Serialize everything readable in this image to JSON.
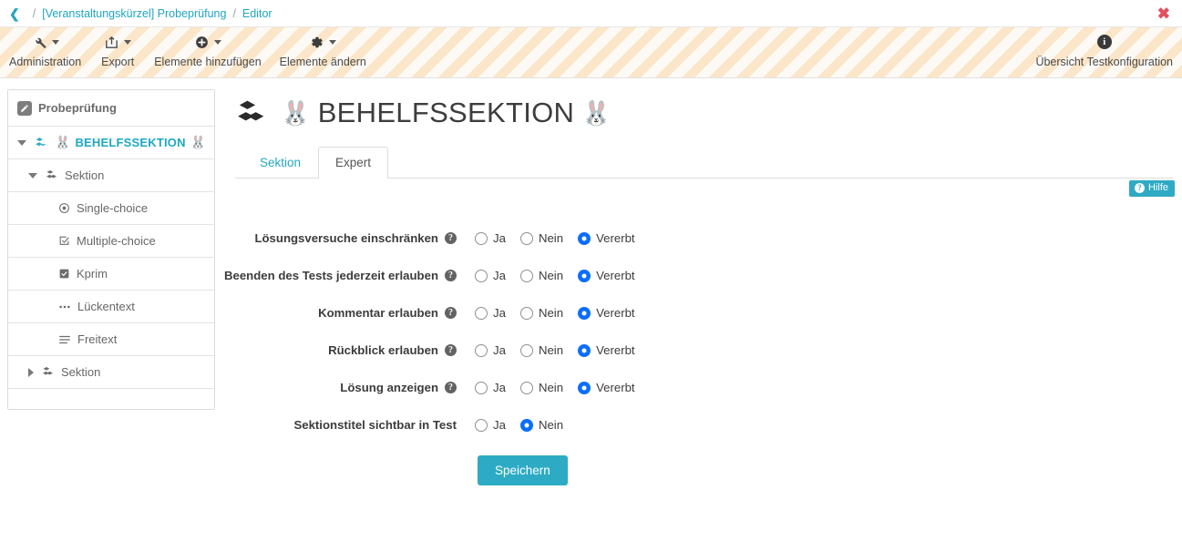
{
  "breadcrumb": {
    "back_icon": "chevron-left-icon",
    "items": [
      "[Veranstaltungskürzel] Probeprüfung",
      "Editor"
    ],
    "separator": "/",
    "close_label": "✖"
  },
  "toolbar": {
    "items": [
      {
        "label": "Administration",
        "icon": "wrench-icon",
        "has_caret": true
      },
      {
        "label": "Export",
        "icon": "share-box-icon",
        "has_caret": true
      },
      {
        "label": "Elemente hinzufügen",
        "icon": "plus-circle-icon",
        "has_caret": true
      },
      {
        "label": "Elemente ändern",
        "icon": "gear-icon",
        "has_caret": true
      }
    ],
    "right": {
      "label": "Übersicht Testkonfiguration",
      "icon": "info-circle-icon",
      "glyph": "i"
    }
  },
  "sidebar": {
    "header": {
      "label": "Probeprüfung",
      "icon": "pencil-icon"
    },
    "items": [
      {
        "label": "BEHELFSSEKTION",
        "icon": "blocks-icon",
        "emoji_before": "🐰",
        "emoji_after": "🐰",
        "state": "expanded",
        "level": 0,
        "active": true
      },
      {
        "label": "Sektion",
        "icon": "blocks-icon",
        "state": "expanded",
        "level": 1,
        "active": false
      },
      {
        "label": "Single-choice",
        "icon": "radio-icon",
        "state": "leaf",
        "level": 2,
        "active": false
      },
      {
        "label": "Multiple-choice",
        "icon": "checkbox-outline-icon",
        "state": "leaf",
        "level": 2,
        "active": false
      },
      {
        "label": "Kprim",
        "icon": "checkbox-filled-icon",
        "state": "leaf",
        "level": 2,
        "active": false
      },
      {
        "label": "Lückentext",
        "icon": "dots-icon",
        "state": "leaf",
        "level": 2,
        "active": false
      },
      {
        "label": "Freitext",
        "icon": "lines-icon",
        "state": "leaf",
        "level": 2,
        "active": false
      },
      {
        "label": "Sektion",
        "icon": "blocks-icon",
        "state": "collapsed",
        "level": 1,
        "active": false
      }
    ]
  },
  "page": {
    "title": "BEHELFSSEKTION",
    "title_icon": "blocks-icon",
    "emoji_before": "🐰",
    "emoji_after": "🐰"
  },
  "tabs": [
    {
      "label": "Sektion",
      "active": false
    },
    {
      "label": "Expert",
      "active": true
    }
  ],
  "help_button": {
    "label": "Hilfe",
    "glyph": "?"
  },
  "form": {
    "rows": [
      {
        "label": "Lösungsversuche einschränken",
        "has_help": true,
        "options": [
          {
            "label": "Ja",
            "selected": false
          },
          {
            "label": "Nein",
            "selected": false
          },
          {
            "label": "Vererbt",
            "selected": true
          }
        ]
      },
      {
        "label": "Beenden des Tests jederzeit erlauben",
        "has_help": true,
        "options": [
          {
            "label": "Ja",
            "selected": false
          },
          {
            "label": "Nein",
            "selected": false
          },
          {
            "label": "Vererbt",
            "selected": true
          }
        ]
      },
      {
        "label": "Kommentar erlauben",
        "has_help": true,
        "options": [
          {
            "label": "Ja",
            "selected": false
          },
          {
            "label": "Nein",
            "selected": false
          },
          {
            "label": "Vererbt",
            "selected": true
          }
        ]
      },
      {
        "label": "Rückblick erlauben",
        "has_help": true,
        "options": [
          {
            "label": "Ja",
            "selected": false
          },
          {
            "label": "Nein",
            "selected": false
          },
          {
            "label": "Vererbt",
            "selected": true
          }
        ]
      },
      {
        "label": "Lösung anzeigen",
        "has_help": true,
        "options": [
          {
            "label": "Ja",
            "selected": false
          },
          {
            "label": "Nein",
            "selected": false
          },
          {
            "label": "Vererbt",
            "selected": true
          }
        ]
      },
      {
        "label": "Sektionstitel sichtbar in Test",
        "has_help": false,
        "options": [
          {
            "label": "Ja",
            "selected": false
          },
          {
            "label": "Nein",
            "selected": true
          }
        ]
      }
    ],
    "submit_label": "Speichern"
  },
  "colors": {
    "accent_teal": "#2eabc4",
    "link_teal": "#1fa5c0",
    "radio_blue": "#0b6efd",
    "close_red": "#e05260",
    "stripe": "#fbe6c9"
  }
}
